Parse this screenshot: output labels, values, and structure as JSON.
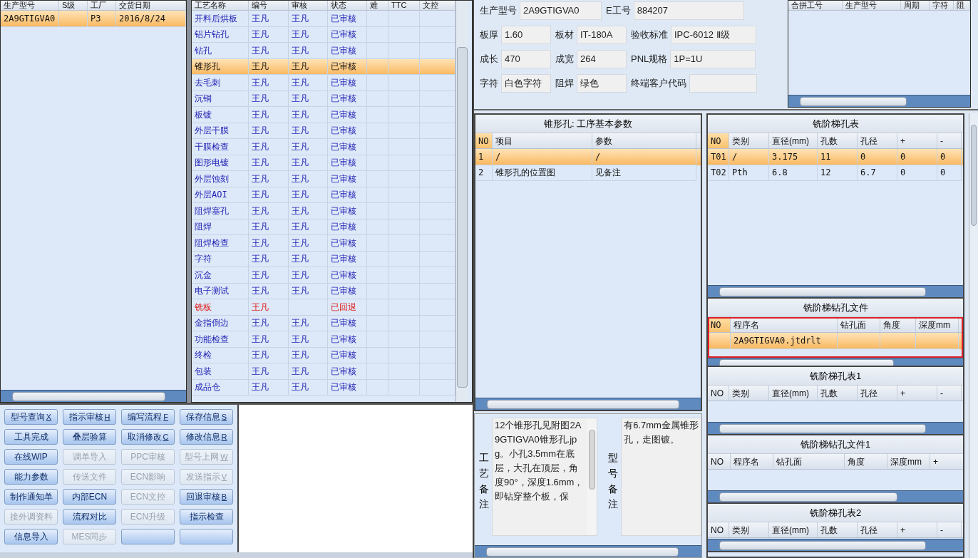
{
  "product_list": {
    "columns": [
      "生产型号",
      "S级",
      "工厂",
      "交货日期"
    ],
    "rows": [
      {
        "cells": [
          "2A9GTIGVA0",
          null,
          "P3",
          "2016/8/24"
        ],
        "selected": true
      }
    ]
  },
  "process_list": {
    "columns": [
      "工艺名称",
      "编号",
      "审核",
      "状态",
      "难",
      "TTC",
      "文控"
    ],
    "rows": [
      {
        "name": "开料后烘板",
        "code": "王凡",
        "reviewer": "王凡",
        "status": "已审核",
        "selected": false,
        "returned": false
      },
      {
        "name": "铝片钻孔",
        "code": "王凡",
        "reviewer": "王凡",
        "status": "已审核",
        "selected": false,
        "returned": false
      },
      {
        "name": "钻孔",
        "code": "王凡",
        "reviewer": "王凡",
        "status": "已审核",
        "selected": false,
        "returned": false
      },
      {
        "name": "锥形孔",
        "code": "王凡",
        "reviewer": "王凡",
        "status": "已审核",
        "selected": true,
        "returned": false
      },
      {
        "name": "去毛刺",
        "code": "王凡",
        "reviewer": "王凡",
        "status": "已审核",
        "selected": false,
        "returned": false
      },
      {
        "name": "沉铜",
        "code": "王凡",
        "reviewer": "王凡",
        "status": "已审核",
        "selected": false,
        "returned": false
      },
      {
        "name": "板镀",
        "code": "王凡",
        "reviewer": "王凡",
        "status": "已审核",
        "selected": false,
        "returned": false
      },
      {
        "name": "外层干膜",
        "code": "王凡",
        "reviewer": "王凡",
        "status": "已审核",
        "selected": false,
        "returned": false
      },
      {
        "name": "干膜检查",
        "code": "王凡",
        "reviewer": "王凡",
        "status": "已审核",
        "selected": false,
        "returned": false
      },
      {
        "name": "图形电镀",
        "code": "王凡",
        "reviewer": "王凡",
        "status": "已审核",
        "selected": false,
        "returned": false
      },
      {
        "name": "外层蚀刻",
        "code": "王凡",
        "reviewer": "王凡",
        "status": "已审核",
        "selected": false,
        "returned": false
      },
      {
        "name": "外层AOI",
        "code": "王凡",
        "reviewer": "王凡",
        "status": "已审核",
        "selected": false,
        "returned": false
      },
      {
        "name": "阻焊塞孔",
        "code": "王凡",
        "reviewer": "王凡",
        "status": "已审核",
        "selected": false,
        "returned": false
      },
      {
        "name": "阻焊",
        "code": "王凡",
        "reviewer": "王凡",
        "status": "已审核",
        "selected": false,
        "returned": false
      },
      {
        "name": "阻焊检查",
        "code": "王凡",
        "reviewer": "王凡",
        "status": "已审核",
        "selected": false,
        "returned": false
      },
      {
        "name": "字符",
        "code": "王凡",
        "reviewer": "王凡",
        "status": "已审核",
        "selected": false,
        "returned": false
      },
      {
        "name": "沉金",
        "code": "王凡",
        "reviewer": "王凡",
        "status": "已审核",
        "selected": false,
        "returned": false
      },
      {
        "name": "电子测试",
        "code": "王凡",
        "reviewer": "王凡",
        "status": "已审核",
        "selected": false,
        "returned": false
      },
      {
        "name": "铣板",
        "code": "王凡",
        "reviewer": null,
        "status": "已回退",
        "selected": false,
        "returned": true
      },
      {
        "name": "金指倒边",
        "code": "王凡",
        "reviewer": "王凡",
        "status": "已审核",
        "selected": false,
        "returned": false
      },
      {
        "name": "功能检查",
        "code": "王凡",
        "reviewer": "王凡",
        "status": "已审核",
        "selected": false,
        "returned": false
      },
      {
        "name": "终检",
        "code": "王凡",
        "reviewer": "王凡",
        "status": "已审核",
        "selected": false,
        "returned": false
      },
      {
        "name": "包装",
        "code": "王凡",
        "reviewer": "王凡",
        "status": "已审核",
        "selected": false,
        "returned": false
      },
      {
        "name": "成品仓",
        "code": "王凡",
        "reviewer": "王凡",
        "status": "已审核",
        "selected": false,
        "returned": false
      }
    ]
  },
  "buttons": [
    {
      "label": "型号查询",
      "hotkey": "X",
      "disabled": false
    },
    {
      "label": "指示审核",
      "hotkey": "H",
      "disabled": false
    },
    {
      "label": "编写流程",
      "hotkey": "F",
      "disabled": false
    },
    {
      "label": "保存信息",
      "hotkey": "S",
      "disabled": false
    },
    {
      "label": "工具完成",
      "disabled": false
    },
    {
      "label": "叠层验算",
      "disabled": false
    },
    {
      "label": "取消修改",
      "hotkey": "C",
      "disabled": false
    },
    {
      "label": "修改信息",
      "hotkey": "R",
      "disabled": false
    },
    {
      "label": "在线WIP",
      "disabled": false
    },
    {
      "label": "调单导入",
      "disabled": true
    },
    {
      "label": "PPC审核",
      "disabled": true
    },
    {
      "label": "型号上网",
      "hotkey": "W",
      "disabled": true
    },
    {
      "label": "能力参数",
      "disabled": false
    },
    {
      "label": "传送文件",
      "disabled": true
    },
    {
      "label": "ECN影响",
      "disabled": true
    },
    {
      "label": "发送指示",
      "hotkey": "V",
      "disabled": true
    },
    {
      "label": "制作通知单",
      "disabled": false
    },
    {
      "label": "内部ECN",
      "disabled": false
    },
    {
      "label": "ECN文控",
      "disabled": true
    },
    {
      "label": "回退审核",
      "hotkey": "B",
      "disabled": false
    },
    {
      "label": "接外调资料",
      "disabled": true
    },
    {
      "label": "流程对比",
      "disabled": false
    },
    {
      "label": "ECN升级",
      "disabled": true
    },
    {
      "label": "指示检查",
      "disabled": false
    },
    {
      "label": "信息导入",
      "disabled": false
    },
    {
      "label": "MES同步",
      "disabled": true
    },
    {
      "disabled": false
    },
    {
      "disabled": false
    }
  ],
  "info_form": {
    "rows": [
      [
        {
          "label": "生产型号",
          "value": "2A9GTIGVA0"
        },
        {
          "label": "E工号",
          "value": "884207"
        }
      ],
      [
        {
          "label": "板厚",
          "value": "1.60"
        },
        {
          "label": "板材",
          "value": "IT-180A"
        },
        {
          "label": "验收标准",
          "value": "IPC-6012 Ⅱ级"
        }
      ],
      [
        {
          "label": "成长",
          "value": "470"
        },
        {
          "label": "成宽",
          "value": "264"
        },
        {
          "label": "PNL规格",
          "value": "1P=1U"
        }
      ],
      [
        {
          "label": "字符",
          "value": "白色字符"
        },
        {
          "label": "阻焊",
          "value": "绿色"
        },
        {
          "label": "终端客户代码"
        }
      ]
    ]
  },
  "merge_table": {
    "columns": [
      "合拼工号",
      "生产型号",
      "周期",
      "字符",
      "阻"
    ]
  },
  "process_params": {
    "title": "锥形孔: 工序基本参数",
    "columns": [
      "NO",
      "项目",
      "参数"
    ],
    "rows": [
      {
        "cells": [
          "1",
          "/",
          "/"
        ],
        "selected": true
      },
      {
        "cells": [
          "2",
          "锥形孔的位置图",
          "见备注"
        ],
        "selected": false
      }
    ]
  },
  "step_hole_table": {
    "title": "铣阶梯孔表",
    "columns": [
      "NO",
      "类别",
      "直径(mm)",
      "孔数",
      "孔径",
      "+",
      "-"
    ],
    "rows": [
      {
        "cells": [
          "T01",
          "/",
          "3.175",
          "11",
          "0",
          "0",
          "0"
        ],
        "selected": true
      },
      {
        "cells": [
          "T02",
          "Pth",
          "6.8",
          "12",
          "6.7",
          "0",
          "0"
        ],
        "selected": false
      }
    ]
  },
  "step_drill_file": {
    "title": "铣阶梯钻孔文件",
    "highlighted": true,
    "columns": [
      "NO",
      "程序名",
      "钻孔面",
      "角度",
      "深度mm"
    ],
    "rows": [
      {
        "cells": [
          null,
          "2A9GTIGVA0.jtdrlt",
          null,
          null,
          null
        ],
        "selected": true
      }
    ]
  },
  "step_hole_table_1": {
    "title": "铣阶梯孔表1",
    "columns": [
      "NO",
      "类别",
      "直径(mm)",
      "孔数",
      "孔径",
      "+",
      "-"
    ]
  },
  "step_drill_file_1": {
    "title": "铣阶梯钻孔文件1",
    "columns": [
      "NO",
      "程序名",
      "钻孔面",
      "角度",
      "深度mm",
      "+"
    ]
  },
  "step_hole_table_2": {
    "title": "铣阶梯孔表2",
    "columns": [
      "NO",
      "类别",
      "直径(mm)",
      "孔数",
      "孔径",
      "+",
      "-"
    ]
  },
  "process_note": {
    "label": "工艺备注",
    "text": "12个锥形孔见附图2A9GTIGVA0锥形孔.jpg。小孔3.5mm在底层，大孔在顶层，角度90°，深度1.6mm，即钻穿整个板，保"
  },
  "model_note": {
    "label": "型号备注",
    "text": "有6.7mm金属锥形孔，走图镀。"
  }
}
